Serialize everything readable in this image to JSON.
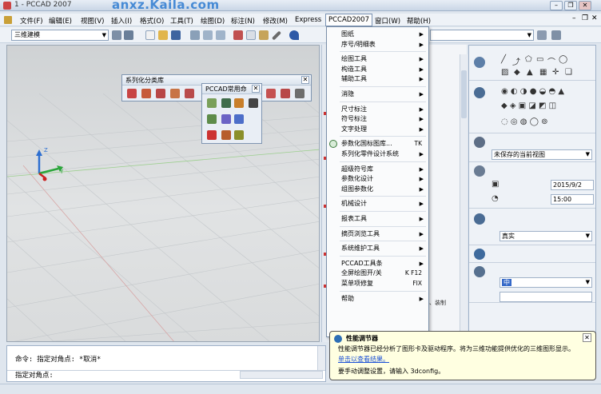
{
  "window": {
    "title": "1 - PCCAD 2007",
    "watermark": "anxz.Kaila.com",
    "controls": [
      "minimize-icon",
      "restore-icon",
      "close-icon"
    ]
  },
  "menubar": {
    "items": [
      "文件(F)",
      "编辑(E)",
      "视图(V)",
      "插入(I)",
      "格式(O)",
      "工具(T)",
      "绘图(D)",
      "标注(N)",
      "修改(M)",
      "Express",
      "PCCAD2007",
      "窗口(W)",
      "帮助(H)"
    ],
    "active": "PCCAD2007"
  },
  "toolbar": {
    "workspace": "三维建模"
  },
  "palettes": {
    "series": {
      "title": "系列化分类库"
    },
    "common": {
      "title": "PCCAD常用命"
    }
  },
  "dropdown": {
    "groups": [
      [
        {
          "label": "图纸",
          "sub": true
        },
        {
          "label": "序号/明细表",
          "sub": true
        }
      ],
      [
        {
          "label": "绘图工具",
          "sub": true
        },
        {
          "label": "构造工具",
          "sub": true
        },
        {
          "label": "辅助工具",
          "sub": true
        }
      ],
      [
        {
          "label": "消隐",
          "sub": true
        }
      ],
      [
        {
          "label": "尺寸标注",
          "sub": true
        },
        {
          "label": "符号标注",
          "sub": true
        },
        {
          "label": "文字处理",
          "sub": true
        }
      ],
      [
        {
          "label": "参数化国标图库...",
          "shortcut": "TK",
          "icon": true
        },
        {
          "label": "系列化零件设计系统",
          "sub": true
        }
      ],
      [
        {
          "label": "超级符号库",
          "sub": true
        },
        {
          "label": "参数化设计",
          "sub": true
        },
        {
          "label": "组图参数化",
          "sub": true
        }
      ],
      [
        {
          "label": "机械设计",
          "sub": true
        }
      ],
      [
        {
          "label": "报表工具",
          "sub": true
        }
      ],
      [
        {
          "label": "摘页浏览工具",
          "sub": true
        }
      ],
      [
        {
          "label": "系统维护工具",
          "sub": true
        }
      ],
      [
        {
          "label": "PCCAD工具条",
          "sub": true
        },
        {
          "label": "全屏绘图开/关",
          "shortcut": "K F12"
        },
        {
          "label": "菜单项修复",
          "shortcut": "FIX"
        }
      ],
      [
        {
          "label": "帮助",
          "sub": true
        }
      ]
    ]
  },
  "midpanel": {
    "fragment": "、装制"
  },
  "rpanel": {
    "view_select": "未保存的当前视图",
    "date": "2015/9/2",
    "time": "15:00",
    "visual_style": "真实",
    "material_value": "中"
  },
  "command": {
    "history": "命令: 指定对角点: *取消*",
    "prompt": "指定对角点:"
  },
  "balloon": {
    "title": "性能调节器",
    "text": "性能调节器已经分析了图形卡及驱动程序。将为三维功能提供优化的三维图形显示。",
    "link": "单击以查看结果。",
    "hint": "要手动调整设置，请输入 3dconfig。"
  },
  "colors": {
    "accent": "#2d6fb5",
    "balloon_bg": "#ffffe1",
    "menu_highlight": "#7a93b3"
  }
}
